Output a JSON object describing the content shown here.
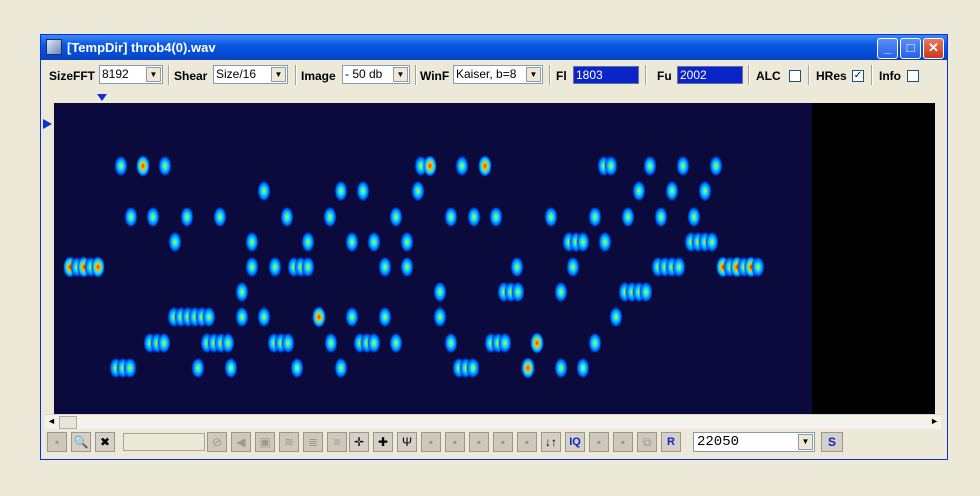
{
  "window": {
    "title": "[TempDir] throb4(0).wav",
    "controls": [
      "_",
      "□",
      "✕"
    ]
  },
  "toolbar": {
    "sizefft_label": "SizeFFT",
    "sizefft_value": "8192",
    "shear_label": "Shear",
    "shear_value": "Size/16",
    "image_label": "Image",
    "image_value": "- 50 db",
    "winf_label": "WinF",
    "winf_value": "Kaiser, b=8",
    "fl_label": "Fl",
    "fl_value": "1803",
    "fu_label": "Fu",
    "fu_value": "2002",
    "alc_label": "ALC",
    "alc_checked": false,
    "hres_label": "HRes",
    "hres_checked": true,
    "info_label": "Info",
    "info_checked": false
  },
  "spectrogram": {
    "colormap": [
      "#0A0A3C",
      "#0055FF",
      "#00E5FF",
      "#FFE000",
      "#FF2000"
    ],
    "background": "#0A0A3C",
    "unrendered_color": "#000000"
  },
  "bottom_toolbar": {
    "buttons": [
      {
        "name": "page-button",
        "glyph": "▪",
        "enabled": false
      },
      {
        "name": "zoom-button",
        "glyph": "🔍",
        "enabled": true
      },
      {
        "name": "delete-button",
        "glyph": "✖",
        "enabled": true
      },
      {
        "name": "stop-button",
        "glyph": "⊘",
        "enabled": false
      },
      {
        "name": "speaker-button",
        "glyph": "◀",
        "enabled": false
      },
      {
        "name": "frame-button",
        "glyph": "▣",
        "enabled": false
      },
      {
        "name": "filter-button",
        "glyph": "≋",
        "enabled": false
      },
      {
        "name": "list-button",
        "glyph": "≣",
        "enabled": false
      },
      {
        "name": "spectrum-button",
        "glyph": "≡",
        "enabled": false
      },
      {
        "name": "tune-up-button",
        "glyph": "✛",
        "enabled": true
      },
      {
        "name": "tune-down-button",
        "glyph": "✚",
        "enabled": true
      },
      {
        "name": "antenna-button",
        "glyph": "Ψ",
        "enabled": true
      },
      {
        "name": "block1-button",
        "glyph": "▪",
        "enabled": false
      },
      {
        "name": "block2-button",
        "glyph": "▪",
        "enabled": false
      },
      {
        "name": "block3-button",
        "glyph": "▪",
        "enabled": false
      },
      {
        "name": "block4-button",
        "glyph": "▪",
        "enabled": false
      },
      {
        "name": "block5-button",
        "glyph": "▪",
        "enabled": false
      },
      {
        "name": "swap-button",
        "glyph": "↓↑",
        "enabled": true
      },
      {
        "name": "iq-button",
        "glyph": "IQ",
        "enabled": true
      },
      {
        "name": "block6-button",
        "glyph": "▪",
        "enabled": false
      },
      {
        "name": "block7-button",
        "glyph": "▪",
        "enabled": false
      },
      {
        "name": "copy-button",
        "glyph": "⧉",
        "enabled": false
      },
      {
        "name": "r-button",
        "glyph": "R",
        "enabled": true
      }
    ],
    "sample_rate": "22050",
    "s_label": "S"
  }
}
